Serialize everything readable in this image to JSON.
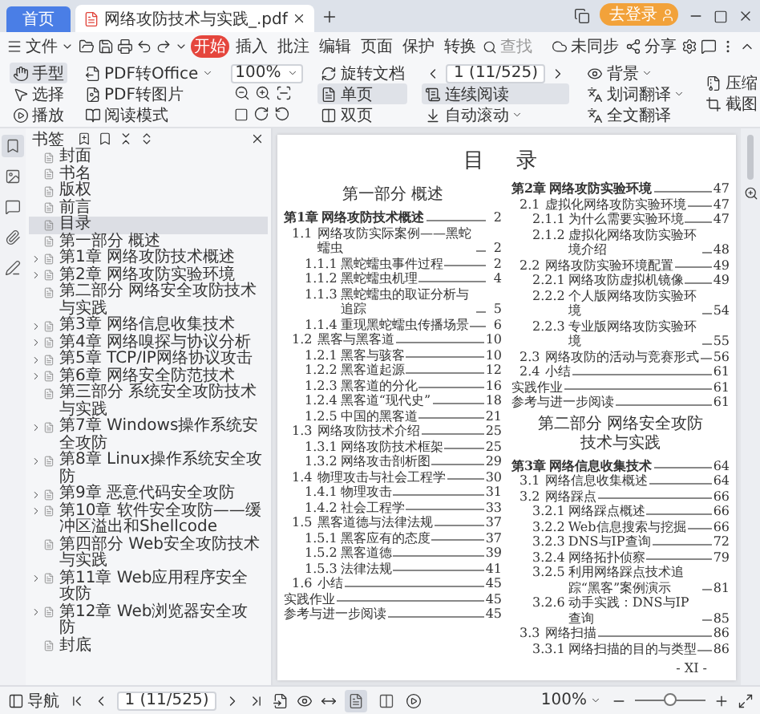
{
  "window_tabs": [
    {
      "label": "首页",
      "kind": "home",
      "selected": false
    },
    {
      "label": "网络攻防技术与实践_.pdf",
      "kind": "document",
      "selected": true
    }
  ],
  "account": {
    "label": "去登录"
  },
  "menu": {
    "file": "文件",
    "tabs": [
      {
        "label": "开始",
        "selected": true
      },
      {
        "label": "插入",
        "selected": false
      },
      {
        "label": "批注",
        "selected": false
      },
      {
        "label": "编辑",
        "selected": false
      },
      {
        "label": "页面",
        "selected": false
      },
      {
        "label": "保护",
        "selected": false
      },
      {
        "label": "转换",
        "selected": false
      }
    ],
    "search": {
      "placeholder": "查找"
    },
    "sync": "未同步",
    "share": "分享"
  },
  "toolbar": {
    "tools": [
      {
        "label": "手型",
        "selected": true
      },
      {
        "label": "选择",
        "selected": false
      }
    ],
    "play": "播放",
    "convert_office": "PDF转Office",
    "convert_image": "PDF转图片",
    "read_mode": "阅读模式",
    "zoom": "100%",
    "rotate": "旋转文档",
    "layouts": [
      {
        "label": "单页",
        "selected": true
      },
      {
        "label": "双页",
        "selected": false
      }
    ],
    "page_field": "1 (11/525)",
    "continuous": {
      "label": "连续阅读",
      "on": true
    },
    "auto_scroll": "自动滚动",
    "background": "背景",
    "translate_word": "划词翻译",
    "translate_full": "全文翻译",
    "compress": "压缩",
    "screenshot": "截图"
  },
  "sidebar": {
    "rail": [
      {
        "selected": true
      },
      {
        "selected": false
      },
      {
        "selected": false
      },
      {
        "selected": false
      },
      {
        "selected": false
      }
    ],
    "title": "书签",
    "bookmarks": [
      {
        "label": "封面",
        "kind": "leaf",
        "selected": false
      },
      {
        "label": "书名",
        "kind": "leaf",
        "selected": false
      },
      {
        "label": "版权",
        "kind": "leaf",
        "selected": false
      },
      {
        "label": "前言",
        "kind": "leaf",
        "selected": false
      },
      {
        "label": "目录",
        "kind": "leaf",
        "selected": true
      },
      {
        "label": "第一部分 概述",
        "kind": "leaf",
        "selected": false
      },
      {
        "label": "第1章 网络攻防技术概述",
        "kind": "group",
        "selected": false
      },
      {
        "label": "第2章 网络攻防实验环境",
        "kind": "group",
        "selected": false
      },
      {
        "label": "第二部分 网络安全攻防技术与实践",
        "kind": "leaf",
        "selected": false
      },
      {
        "label": "第3章 网络信息收集技术",
        "kind": "group",
        "selected": false
      },
      {
        "label": "第4章 网络嗅探与协议分析",
        "kind": "group",
        "selected": false
      },
      {
        "label": "第5章 TCP/IP网络协议攻击",
        "kind": "group",
        "selected": false
      },
      {
        "label": "第6章 网络安全防范技术",
        "kind": "group",
        "selected": false
      },
      {
        "label": "第三部分 系统安全攻防技术与实践",
        "kind": "leaf",
        "selected": false
      },
      {
        "label": "第7章 Windows操作系统安全攻防",
        "kind": "group",
        "selected": false
      },
      {
        "label": "第8章 Linux操作系统安全攻防",
        "kind": "group",
        "selected": false
      },
      {
        "label": "第9章 恶意代码安全攻防",
        "kind": "group",
        "selected": false
      },
      {
        "label": "第10章 软件安全攻防——缓冲区溢出和Shellcode",
        "kind": "group",
        "selected": false
      },
      {
        "label": "第四部分 Web安全攻防技术与实践",
        "kind": "leaf",
        "selected": false
      },
      {
        "label": "第11章 Web应用程序安全攻防",
        "kind": "group",
        "selected": false
      },
      {
        "label": "第12章 Web浏览器安全攻防",
        "kind": "group",
        "selected": false
      },
      {
        "label": "封底",
        "kind": "leaf",
        "selected": false
      }
    ]
  },
  "document": {
    "title": "目 录",
    "columns": [
      [
        {
          "kind": "part",
          "text": "第一部分 概述"
        },
        {
          "kind": "chapter",
          "number": "第1章",
          "title": "网络攻防技术概述",
          "page": "2"
        },
        {
          "kind": "section",
          "number": "1.1",
          "title": "网络攻防实际案例——黑蛇蠕虫",
          "page": "2"
        },
        {
          "kind": "subsection",
          "number": "1.1.1",
          "title": "黑蛇蠕虫事件过程",
          "page": "2"
        },
        {
          "kind": "subsection",
          "number": "1.1.2",
          "title": "黑蛇蠕虫机理",
          "page": "4"
        },
        {
          "kind": "subsection",
          "number": "1.1.3",
          "title": "黑蛇蠕虫的取证分析与追踪",
          "page": "5"
        },
        {
          "kind": "subsection",
          "number": "1.1.4",
          "title": "重现黑蛇蠕虫传播场景",
          "page": "6"
        },
        {
          "kind": "section",
          "number": "1.2",
          "title": "黑客与黑客道",
          "page": "10"
        },
        {
          "kind": "subsection",
          "number": "1.2.1",
          "title": "黑客与骇客",
          "page": "10"
        },
        {
          "kind": "subsection",
          "number": "1.2.2",
          "title": "黑客道起源",
          "page": "12"
        },
        {
          "kind": "subsection",
          "number": "1.2.3",
          "title": "黑客道的分化",
          "page": "16"
        },
        {
          "kind": "subsection",
          "number": "1.2.4",
          "title": "黑客道“现代史”",
          "page": "18"
        },
        {
          "kind": "subsection",
          "number": "1.2.5",
          "title": "中国的黑客道",
          "page": "21"
        },
        {
          "kind": "section",
          "number": "1.3",
          "title": "网络攻防技术介绍",
          "page": "25"
        },
        {
          "kind": "subsection",
          "number": "1.3.1",
          "title": "网络攻防技术框架",
          "page": "25"
        },
        {
          "kind": "subsection",
          "number": "1.3.2",
          "title": "网络攻击剖析图",
          "page": "29"
        },
        {
          "kind": "section",
          "number": "1.4",
          "title": "物理攻击与社会工程学",
          "page": "30"
        },
        {
          "kind": "subsection",
          "number": "1.4.1",
          "title": "物理攻击",
          "page": "31"
        },
        {
          "kind": "subsection",
          "number": "1.4.2",
          "title": "社会工程学",
          "page": "33"
        },
        {
          "kind": "section",
          "number": "1.5",
          "title": "黑客道德与法律法规",
          "page": "37"
        },
        {
          "kind": "subsection",
          "number": "1.5.1",
          "title": "黑客应有的态度",
          "page": "37"
        },
        {
          "kind": "subsection",
          "number": "1.5.2",
          "title": "黑客道德",
          "page": "39"
        },
        {
          "kind": "subsection",
          "number": "1.5.3",
          "title": "法律法规",
          "page": "41"
        },
        {
          "kind": "section",
          "number": "1.6",
          "title": "小结",
          "page": "45"
        },
        {
          "kind": "plain",
          "title": "实践作业",
          "page": "45"
        },
        {
          "kind": "plain",
          "title": "参考与进一步阅读",
          "page": "45"
        }
      ],
      [
        {
          "kind": "chapter",
          "number": "第2章",
          "title": "网络攻防实验环境",
          "page": "47"
        },
        {
          "kind": "section",
          "number": "2.1",
          "title": "虚拟化网络攻防实验环境",
          "page": "47"
        },
        {
          "kind": "subsection",
          "number": "2.1.1",
          "title": "为什么需要实验环境",
          "page": "47"
        },
        {
          "kind": "subsection",
          "number": "2.1.2",
          "title": "虚拟化网络攻防实验环境介绍",
          "page": "48"
        },
        {
          "kind": "section",
          "number": "2.2",
          "title": "网络攻防实验环境配置",
          "page": "49"
        },
        {
          "kind": "subsection",
          "number": "2.2.1",
          "title": "网络攻防虚拟机镜像",
          "page": "49"
        },
        {
          "kind": "subsection",
          "number": "2.2.2",
          "title": "个人版网络攻防实验环境",
          "page": "54"
        },
        {
          "kind": "subsection",
          "number": "2.2.3",
          "title": "专业版网络攻防实验环境",
          "page": "55"
        },
        {
          "kind": "section",
          "number": "2.3",
          "title": "网络攻防的活动与竞赛形式",
          "page": "56"
        },
        {
          "kind": "section",
          "number": "2.4",
          "title": "小结",
          "page": "61"
        },
        {
          "kind": "plain",
          "title": "实践作业",
          "page": "61"
        },
        {
          "kind": "plain",
          "title": "参考与进一步阅读",
          "page": "61"
        },
        {
          "kind": "part",
          "text": "第二部分 网络安全攻防技术与实践"
        },
        {
          "kind": "chapter",
          "number": "第3章",
          "title": "网络信息收集技术",
          "page": "64"
        },
        {
          "kind": "section",
          "number": "3.1",
          "title": "网络信息收集概述",
          "page": "64"
        },
        {
          "kind": "section",
          "number": "3.2",
          "title": "网络踩点",
          "page": "66"
        },
        {
          "kind": "subsection",
          "number": "3.2.1",
          "title": "网络踩点概述",
          "page": "66"
        },
        {
          "kind": "subsection",
          "number": "3.2.2",
          "title": "Web信息搜索与挖掘",
          "page": "66"
        },
        {
          "kind": "subsection",
          "number": "3.2.3",
          "title": "DNS与IP查询",
          "page": "72"
        },
        {
          "kind": "subsection",
          "number": "3.2.4",
          "title": "网络拓扑侦察",
          "page": "79"
        },
        {
          "kind": "subsection",
          "number": "3.2.5",
          "title": "利用网络踩点技术追踪“黑客”案例演示",
          "page": "81"
        },
        {
          "kind": "subsection",
          "number": "3.2.6",
          "title": "动手实践：DNS与IP查询",
          "page": "85"
        },
        {
          "kind": "section",
          "number": "3.3",
          "title": "网络扫描",
          "page": "86"
        },
        {
          "kind": "subsection",
          "number": "3.3.1",
          "title": "网络扫描的目的与类型",
          "page": "86"
        }
      ]
    ],
    "page_label": "- XI -"
  },
  "status": {
    "nav_label": "导航",
    "page_field": "1 (11/525)",
    "page_modes": [
      {
        "selected": true
      },
      {
        "selected": false
      }
    ],
    "zoom": "100%",
    "zoom_slider": {
      "level": 0.5
    }
  }
}
